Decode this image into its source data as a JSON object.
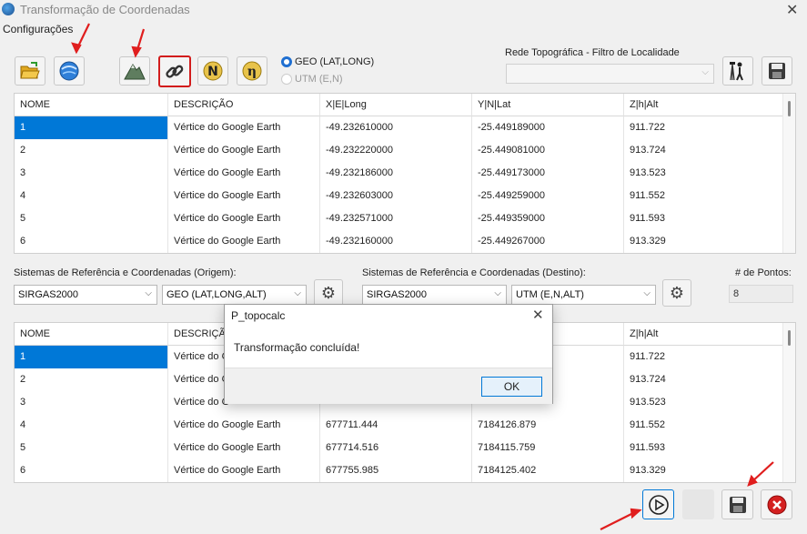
{
  "window": {
    "title": "Transformação de Coordenadas"
  },
  "menu": {
    "config_label": "Configurações"
  },
  "toolbar": {
    "radio_geo": "GEO (LAT,LONG)",
    "radio_utm": "UTM (E,N)",
    "rede_label": "Rede Topográfica - Filtro de Localidade",
    "rede_value": ""
  },
  "top_table": {
    "headers": [
      "NOME",
      "DESCRIÇÃO",
      "X|E|Long",
      "Y|N|Lat",
      "Z|h|Alt"
    ],
    "rows": [
      [
        "1",
        "Vértice do Google Earth",
        "-49.232610000",
        "-25.449189000",
        "911.722"
      ],
      [
        "2",
        "Vértice do Google Earth",
        "-49.232220000",
        "-25.449081000",
        "913.724"
      ],
      [
        "3",
        "Vértice do Google Earth",
        "-49.232186000",
        "-25.449173000",
        "913.523"
      ],
      [
        "4",
        "Vértice do Google Earth",
        "-49.232603000",
        "-25.449259000",
        "911.552"
      ],
      [
        "5",
        "Vértice do Google Earth",
        "-49.232571000",
        "-25.449359000",
        "911.593"
      ],
      [
        "6",
        "Vértice do Google Earth",
        "-49.232160000",
        "-25.449267000",
        "913.329"
      ]
    ]
  },
  "reference": {
    "origem_label": "Sistemas de Referência e Coordenadas (Origem):",
    "origem_datum": "SIRGAS2000",
    "origem_type": "GEO (LAT,LONG,ALT)",
    "destino_label": "Sistemas de Referência e Coordenadas (Destino):",
    "destino_datum": "SIRGAS2000",
    "destino_type": "UTM (E,N,ALT)",
    "pontos_label": "# de Pontos:",
    "pontos_value": "8"
  },
  "bottom_table": {
    "headers": [
      "NOME",
      "DESCRIÇÃO",
      "",
      "",
      "Z|h|Alt"
    ],
    "rows": [
      [
        "1",
        "Vértice do G",
        "",
        "",
        "911.722"
      ],
      [
        "2",
        "Vértice do G",
        "",
        "",
        "913.724"
      ],
      [
        "3",
        "Vértice do G",
        "",
        "",
        "913.523"
      ],
      [
        "4",
        "Vértice do Google Earth",
        "677711.444",
        "7184126.879",
        "911.552"
      ],
      [
        "5",
        "Vértice do Google Earth",
        "677714.516",
        "7184115.759",
        "911.593"
      ],
      [
        "6",
        "Vértice do Google Earth",
        "677755.985",
        "7184125.402",
        "913.329"
      ]
    ]
  },
  "dialog": {
    "title": "P_topocalc",
    "message": "Transformação concluída!",
    "ok_label": "OK"
  },
  "colors": {
    "selection": "#0078d7",
    "highlight_border": "#d21c1c",
    "arrow": "#e01e1e"
  }
}
